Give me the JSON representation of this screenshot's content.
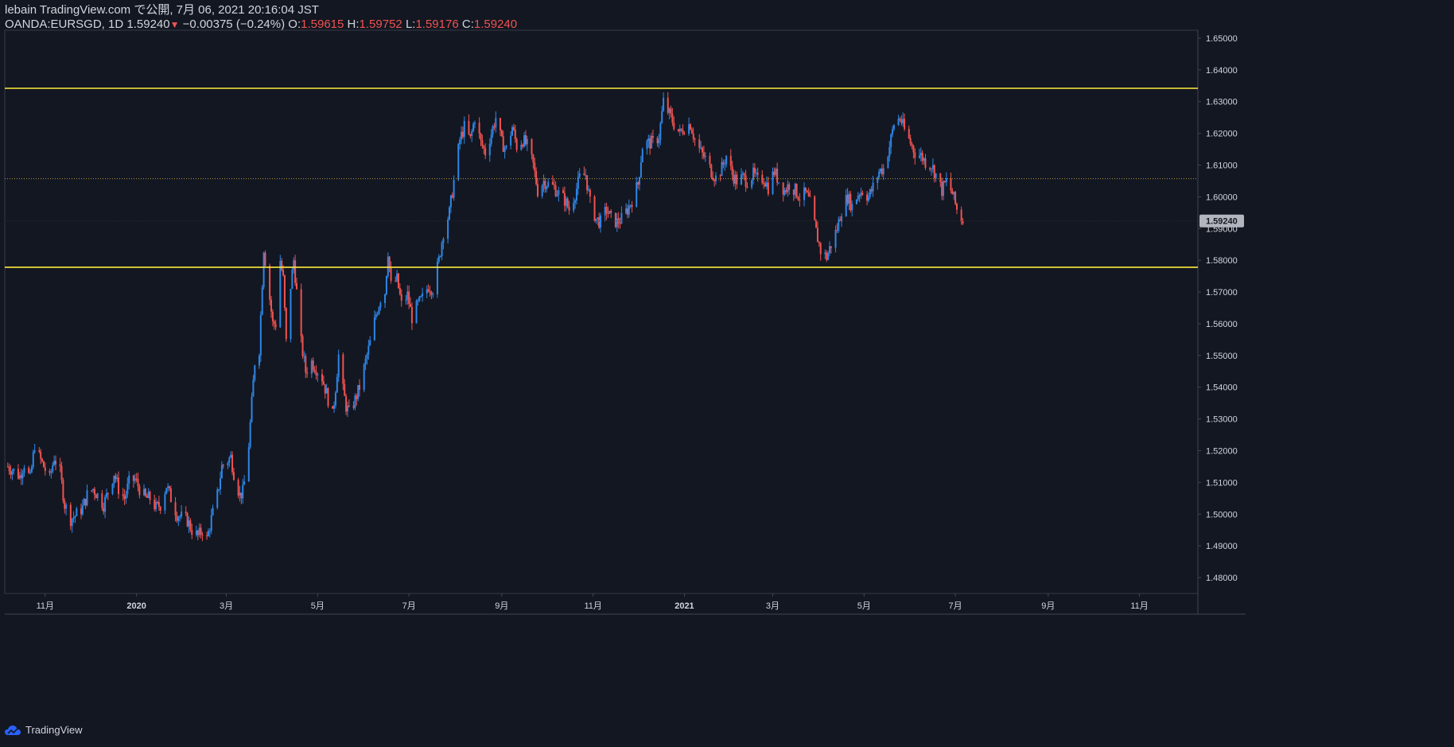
{
  "header": {
    "line1": "lebain TradingView.com で公開, 7月 06, 2021 20:16:04 JST",
    "symbol": "OANDA:EURSGD, 1D",
    "last": "1.59240",
    "change": "−0.00375 (−0.24%)",
    "o_label": "O:",
    "o_val": "1.59615",
    "h_label": "H:",
    "h_val": "1.59752",
    "l_label": "L:",
    "l_val": "1.59176",
    "c_label": "C:",
    "c_val": "1.59240"
  },
  "brand": {
    "name": "TradingView",
    "icon": "tradingview-cloud-icon"
  },
  "colors": {
    "background": "#131722",
    "up": "#2e86e6",
    "down": "#ef5350",
    "level": "#ffeb3b",
    "text": "#d1d4dc"
  },
  "chart_data": {
    "type": "candlestick",
    "title": "",
    "symbol": "OANDA:EURSGD",
    "interval": "1D",
    "ylim": [
      1.475,
      1.6525
    ],
    "y_ticks": [
      "1.48000",
      "1.49000",
      "1.50000",
      "1.51000",
      "1.52000",
      "1.53000",
      "1.54000",
      "1.55000",
      "1.56000",
      "1.57000",
      "1.58000",
      "1.59000",
      "1.60000",
      "1.61000",
      "1.62000",
      "1.63000",
      "1.64000",
      "1.65000"
    ],
    "x_ticks": [
      {
        "label": "11月",
        "date": "2019-11-01"
      },
      {
        "label": "2020",
        "date": "2020-01-01"
      },
      {
        "label": "3月",
        "date": "2020-03-01"
      },
      {
        "label": "5月",
        "date": "2020-05-01"
      },
      {
        "label": "7月",
        "date": "2020-07-01"
      },
      {
        "label": "9月",
        "date": "2020-09-01"
      },
      {
        "label": "11月",
        "date": "2020-11-01"
      },
      {
        "label": "2021",
        "date": "2021-01-01"
      },
      {
        "label": "3月",
        "date": "2021-03-01"
      },
      {
        "label": "5月",
        "date": "2021-05-01"
      },
      {
        "label": "7月",
        "date": "2021-07-01"
      },
      {
        "label": "9月",
        "date": "2021-09-01"
      },
      {
        "label": "11月",
        "date": "2021-11-01"
      }
    ],
    "x_range": [
      "2019-10-05",
      "2021-12-10"
    ],
    "current_price": "1.59240",
    "horizontal_levels": [
      {
        "value": 1.6342,
        "style": "solid",
        "color": "#ffeb3b"
      },
      {
        "value": 1.5778,
        "style": "solid",
        "color": "#ffeb3b"
      },
      {
        "value": 1.6057,
        "style": "dotted",
        "color": "#b59a3a"
      }
    ],
    "close_path": [
      [
        "2019-10-07",
        1.515
      ],
      [
        "2019-10-10",
        1.514
      ],
      [
        "2019-10-15",
        1.512
      ],
      [
        "2019-10-18",
        1.516
      ],
      [
        "2019-10-22",
        1.511
      ],
      [
        "2019-10-25",
        1.522
      ],
      [
        "2019-10-28",
        1.518
      ],
      [
        "2019-10-31",
        1.515
      ],
      [
        "2019-11-04",
        1.511
      ],
      [
        "2019-11-07",
        1.518
      ],
      [
        "2019-11-11",
        1.513
      ],
      [
        "2019-11-14",
        1.503
      ],
      [
        "2019-11-18",
        1.4985
      ],
      [
        "2019-11-21",
        1.4995
      ],
      [
        "2019-11-26",
        1.502
      ],
      [
        "2019-11-29",
        1.506
      ],
      [
        "2019-12-03",
        1.508
      ],
      [
        "2019-12-06",
        1.506
      ],
      [
        "2019-12-10",
        1.503
      ],
      [
        "2019-12-13",
        1.507
      ],
      [
        "2019-12-17",
        1.513
      ],
      [
        "2019-12-20",
        1.508
      ],
      [
        "2019-12-24",
        1.505
      ],
      [
        "2019-12-27",
        1.51
      ],
      [
        "2019-12-31",
        1.511
      ],
      [
        "2020-01-03",
        1.508
      ],
      [
        "2020-01-07",
        1.505
      ],
      [
        "2020-01-10",
        1.505
      ],
      [
        "2020-01-14",
        1.502
      ],
      [
        "2020-01-17",
        1.503
      ],
      [
        "2020-01-21",
        1.509
      ],
      [
        "2020-01-24",
        1.505
      ],
      [
        "2020-01-28",
        1.5
      ],
      [
        "2020-01-31",
        1.499
      ],
      [
        "2020-02-04",
        1.498
      ],
      [
        "2020-02-07",
        1.495
      ],
      [
        "2020-02-11",
        1.493
      ],
      [
        "2020-02-14",
        1.495
      ],
      [
        "2020-02-17",
        1.492
      ],
      [
        "2020-02-20",
        1.4985
      ],
      [
        "2020-02-24",
        1.506
      ],
      [
        "2020-02-27",
        1.515
      ],
      [
        "2020-03-02",
        1.517
      ],
      [
        "2020-03-04",
        1.518
      ],
      [
        "2020-03-06",
        1.513
      ],
      [
        "2020-03-10",
        1.506
      ],
      [
        "2020-03-12",
        1.507
      ],
      [
        "2020-03-14",
        1.513
      ],
      [
        "2020-03-16",
        1.522
      ],
      [
        "2020-03-18",
        1.535
      ],
      [
        "2020-03-20",
        1.548
      ],
      [
        "2020-03-23",
        1.552
      ],
      [
        "2020-03-26",
        1.584
      ],
      [
        "2020-03-29",
        1.572
      ],
      [
        "2020-04-01",
        1.56
      ],
      [
        "2020-04-03",
        1.56
      ],
      [
        "2020-04-06",
        1.58
      ],
      [
        "2020-04-08",
        1.574
      ],
      [
        "2020-04-10",
        1.554
      ],
      [
        "2020-04-13",
        1.572
      ],
      [
        "2020-04-15",
        1.58
      ],
      [
        "2020-04-17",
        1.57
      ],
      [
        "2020-04-20",
        1.554
      ],
      [
        "2020-04-23",
        1.545
      ],
      [
        "2020-04-27",
        1.548
      ],
      [
        "2020-04-30",
        1.546
      ],
      [
        "2020-05-04",
        1.543
      ],
      [
        "2020-05-07",
        1.538
      ],
      [
        "2020-05-11",
        1.531
      ],
      [
        "2020-05-13",
        1.54
      ],
      [
        "2020-05-15",
        1.55
      ],
      [
        "2020-05-18",
        1.539
      ],
      [
        "2020-05-20",
        1.534
      ],
      [
        "2020-05-22",
        1.532
      ],
      [
        "2020-05-26",
        1.536
      ],
      [
        "2020-05-29",
        1.54
      ],
      [
        "2020-06-02",
        1.548
      ],
      [
        "2020-06-05",
        1.554
      ],
      [
        "2020-06-09",
        1.563
      ],
      [
        "2020-06-12",
        1.568
      ],
      [
        "2020-06-15",
        1.57
      ],
      [
        "2020-06-17",
        1.583
      ],
      [
        "2020-06-19",
        1.572
      ],
      [
        "2020-06-23",
        1.574
      ],
      [
        "2020-06-26",
        1.566
      ],
      [
        "2020-06-30",
        1.569
      ],
      [
        "2020-07-03",
        1.562
      ],
      [
        "2020-07-07",
        1.566
      ],
      [
        "2020-07-10",
        1.568
      ],
      [
        "2020-07-14",
        1.572
      ],
      [
        "2020-07-17",
        1.571
      ],
      [
        "2020-07-21",
        1.58
      ],
      [
        "2020-07-24",
        1.589
      ],
      [
        "2020-07-28",
        1.595
      ],
      [
        "2020-07-31",
        1.605
      ],
      [
        "2020-08-04",
        1.618
      ],
      [
        "2020-08-07",
        1.622
      ],
      [
        "2020-08-11",
        1.618
      ],
      [
        "2020-08-14",
        1.625
      ],
      [
        "2020-08-18",
        1.617
      ],
      [
        "2020-08-21",
        1.614
      ],
      [
        "2020-08-25",
        1.62
      ],
      [
        "2020-08-28",
        1.625
      ],
      [
        "2020-09-01",
        1.617
      ],
      [
        "2020-09-04",
        1.615
      ],
      [
        "2020-09-08",
        1.622
      ],
      [
        "2020-09-11",
        1.616
      ],
      [
        "2020-09-15",
        1.618
      ],
      [
        "2020-09-18",
        1.616
      ],
      [
        "2020-09-22",
        1.61
      ],
      [
        "2020-09-25",
        1.602
      ],
      [
        "2020-09-29",
        1.605
      ],
      [
        "2020-10-02",
        1.604
      ],
      [
        "2020-10-06",
        1.603
      ],
      [
        "2020-10-09",
        1.601
      ],
      [
        "2020-10-13",
        1.599
      ],
      [
        "2020-10-16",
        1.596
      ],
      [
        "2020-10-20",
        1.601
      ],
      [
        "2020-10-23",
        1.606
      ],
      [
        "2020-10-27",
        1.607
      ],
      [
        "2020-10-30",
        1.598
      ],
      [
        "2020-11-03",
        1.593
      ],
      [
        "2020-11-06",
        1.592
      ],
      [
        "2020-11-10",
        1.596
      ],
      [
        "2020-11-13",
        1.593
      ],
      [
        "2020-11-17",
        1.592
      ],
      [
        "2020-11-20",
        1.593
      ],
      [
        "2020-11-24",
        1.596
      ],
      [
        "2020-11-27",
        1.599
      ],
      [
        "2020-12-01",
        1.604
      ],
      [
        "2020-12-04",
        1.616
      ],
      [
        "2020-12-08",
        1.617
      ],
      [
        "2020-12-11",
        1.617
      ],
      [
        "2020-12-15",
        1.619
      ],
      [
        "2020-12-18",
        1.63
      ],
      [
        "2020-12-22",
        1.626
      ],
      [
        "2020-12-25",
        1.623
      ],
      [
        "2020-12-29",
        1.62
      ],
      [
        "2021-01-01",
        1.622
      ],
      [
        "2021-01-05",
        1.623
      ],
      [
        "2021-01-08",
        1.618
      ],
      [
        "2021-01-12",
        1.614
      ],
      [
        "2021-01-15",
        1.612
      ],
      [
        "2021-01-19",
        1.608
      ],
      [
        "2021-01-22",
        1.606
      ],
      [
        "2021-01-26",
        1.609
      ],
      [
        "2021-01-29",
        1.613
      ],
      [
        "2021-02-02",
        1.607
      ],
      [
        "2021-02-05",
        1.605
      ],
      [
        "2021-02-09",
        1.606
      ],
      [
        "2021-02-12",
        1.605
      ],
      [
        "2021-02-16",
        1.607
      ],
      [
        "2021-02-19",
        1.605
      ],
      [
        "2021-02-23",
        1.606
      ],
      [
        "2021-02-26",
        1.603
      ],
      [
        "2021-03-02",
        1.608
      ],
      [
        "2021-03-05",
        1.605
      ],
      [
        "2021-03-09",
        1.602
      ],
      [
        "2021-03-12",
        1.604
      ],
      [
        "2021-03-16",
        1.602
      ],
      [
        "2021-03-19",
        1.6
      ],
      [
        "2021-03-23",
        1.601
      ],
      [
        "2021-03-26",
        1.598
      ],
      [
        "2021-03-30",
        1.589
      ],
      [
        "2021-04-02",
        1.583
      ],
      [
        "2021-04-06",
        1.581
      ],
      [
        "2021-04-09",
        1.585
      ],
      [
        "2021-04-13",
        1.59
      ],
      [
        "2021-04-16",
        1.596
      ],
      [
        "2021-04-20",
        1.6
      ],
      [
        "2021-04-23",
        1.597
      ],
      [
        "2021-04-27",
        1.601
      ],
      [
        "2021-04-30",
        1.602
      ],
      [
        "2021-05-04",
        1.6
      ],
      [
        "2021-05-07",
        1.603
      ],
      [
        "2021-05-11",
        1.608
      ],
      [
        "2021-05-14",
        1.609
      ],
      [
        "2021-05-18",
        1.616
      ],
      [
        "2021-05-21",
        1.623
      ],
      [
        "2021-05-25",
        1.625
      ],
      [
        "2021-05-28",
        1.621
      ],
      [
        "2021-06-01",
        1.617
      ],
      [
        "2021-06-04",
        1.614
      ],
      [
        "2021-06-08",
        1.613
      ],
      [
        "2021-06-11",
        1.611
      ],
      [
        "2021-06-15",
        1.61
      ],
      [
        "2021-06-18",
        1.607
      ],
      [
        "2021-06-22",
        1.602
      ],
      [
        "2021-06-25",
        1.605
      ],
      [
        "2021-06-29",
        1.601
      ],
      [
        "2021-07-02",
        1.596
      ],
      [
        "2021-07-06",
        1.5924
      ]
    ]
  }
}
